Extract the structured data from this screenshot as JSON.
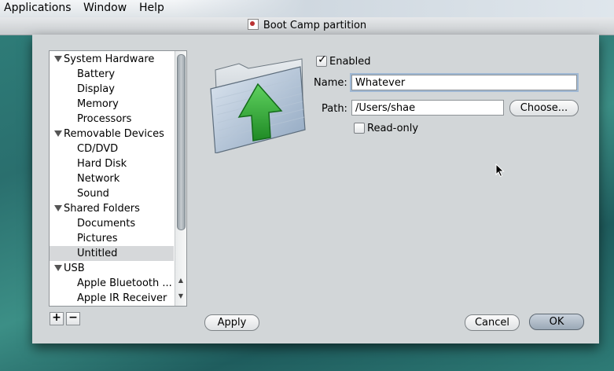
{
  "menubar": {
    "items": [
      "Applications",
      "Window",
      "Help"
    ]
  },
  "window": {
    "title": "Boot Camp partition"
  },
  "sidebar": {
    "groups": [
      {
        "label": "System Hardware",
        "items": [
          "Battery",
          "Display",
          "Memory",
          "Processors"
        ]
      },
      {
        "label": "Removable Devices",
        "items": [
          "CD/DVD",
          "Hard Disk",
          "Network",
          "Sound"
        ]
      },
      {
        "label": "Shared Folders",
        "items": [
          "Documents",
          "Pictures",
          "Untitled"
        ]
      },
      {
        "label": "USB",
        "items": [
          "Apple Bluetooth ...",
          "Apple IR Receiver"
        ]
      }
    ],
    "selected_item": "Untitled",
    "add_label": "+",
    "remove_label": "−"
  },
  "form": {
    "enabled_label": "Enabled",
    "enabled_checked": true,
    "name_label": "Name:",
    "name_value": "Whatever",
    "path_label": "Path:",
    "path_value": "/Users/shae",
    "choose_label": "Choose...",
    "readonly_label": "Read-only",
    "readonly_checked": false
  },
  "buttons": {
    "apply": "Apply",
    "cancel": "Cancel",
    "ok": "OK"
  },
  "icons": {
    "folder": "shared-folder-icon",
    "check": "✓"
  },
  "colors": {
    "dialog_bg": "#d2d6d8",
    "default_button": "#9aa8b6",
    "arrow_green": "#2e9a2e"
  }
}
